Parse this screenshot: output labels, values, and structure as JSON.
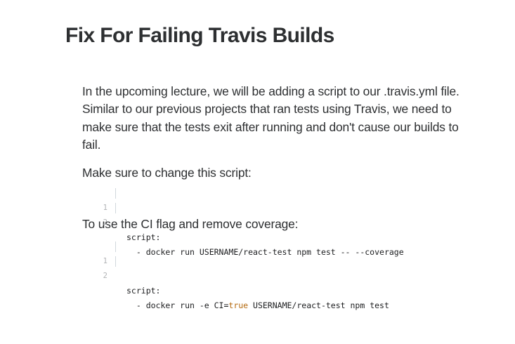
{
  "page": {
    "title": "Fix For Failing Travis Builds"
  },
  "content": {
    "intro": "In the upcoming lecture, we will be adding a script to our .travis.yml file. Similar to our previous projects that ran tests using Travis, we need to make sure that the tests exit after running and don't cause our builds to fail.",
    "change_label": "Make sure to change this script:",
    "change_code": [
      {
        "num": "1",
        "text": "script:"
      },
      {
        "num": "2",
        "text": "  - docker run USERNAME/react-test npm test -- --coverage"
      }
    ],
    "ci_label": "To use the CI flag and remove coverage:",
    "ci_code": [
      {
        "num": "1",
        "text": "script:"
      },
      {
        "num": "2",
        "prefix": "  - docker run -e CI=",
        "keyword": "true",
        "suffix": " USERNAME/react-test npm test"
      }
    ]
  },
  "colors": {
    "text": "#2d2f31",
    "code_keyword": "#b4690e",
    "line_number": "#b0b2b4"
  }
}
